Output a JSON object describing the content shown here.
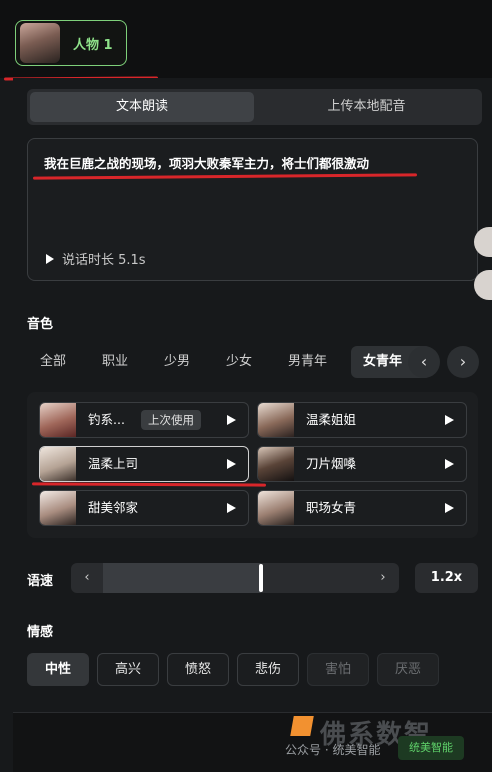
{
  "character": {
    "label": "人物 1"
  },
  "tabs": [
    {
      "label": "文本朗读",
      "active": true
    },
    {
      "label": "上传本地配音",
      "active": false
    }
  ],
  "script": {
    "text": "我在巨鹿之战的现场，项羽大败秦军主力，将士们都很激动",
    "duration": "说话时长 5.1s"
  },
  "voice_section": {
    "title": "音色",
    "categories": [
      "全部",
      "职业",
      "少男",
      "少女",
      "男青年",
      "女青年"
    ],
    "active_category": "女青年",
    "prev_icon": "chevron-left-icon",
    "next_icon": "chevron-right-icon",
    "voices": [
      {
        "name": "钓系...",
        "badge": "上次使用",
        "selected": false
      },
      {
        "name": "温柔姐姐",
        "badge": "",
        "selected": false
      },
      {
        "name": "温柔上司",
        "badge": "",
        "selected": true
      },
      {
        "name": "刀片烟嗓",
        "badge": "",
        "selected": false
      },
      {
        "name": "甜美邻家",
        "badge": "",
        "selected": false
      },
      {
        "name": "职场女青",
        "badge": "",
        "selected": false
      }
    ]
  },
  "speed": {
    "title": "语速",
    "left_arrow": "‹",
    "right_arrow": "›",
    "value": "1.2x",
    "level_fraction": 0.5
  },
  "emotion": {
    "title": "情感",
    "options": [
      {
        "label": "中性",
        "state": "active"
      },
      {
        "label": "高兴",
        "state": "normal"
      },
      {
        "label": "愤怒",
        "state": "normal"
      },
      {
        "label": "悲伤",
        "state": "normal"
      },
      {
        "label": "害怕",
        "state": "disabled"
      },
      {
        "label": "厌恶",
        "state": "disabled"
      }
    ]
  },
  "watermark": {
    "main": "佛系数智",
    "sub": "公众号 · 统美智能",
    "badge": "统美智能"
  },
  "colors": {
    "accent_green": "#8fe38a",
    "annotation_red": "#d8262a",
    "background": "#17191b"
  }
}
